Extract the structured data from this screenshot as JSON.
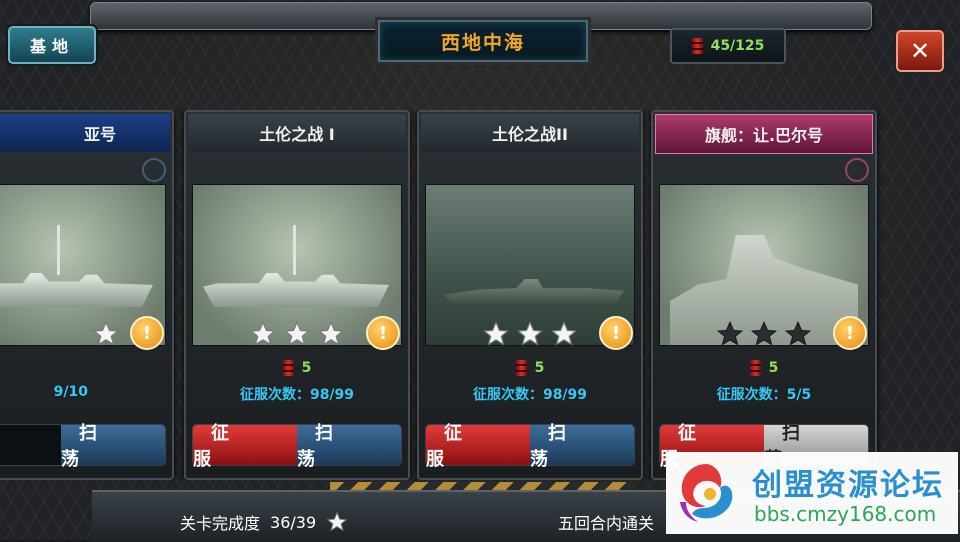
{
  "header": {
    "base_button": "基地",
    "region_title": "西地中海",
    "energy": "45/125",
    "close_label": "✕"
  },
  "cards": [
    {
      "title": "亚号",
      "cost": "",
      "conquer_count": "9/10",
      "stars_earned": 3,
      "conquer_label": "",
      "sweep_label": "扫 荡"
    },
    {
      "title": "土伦之战 I",
      "cost": "5",
      "conquer_count": "征服次数：98/99",
      "stars_earned": 3,
      "conquer_label": "征 服",
      "sweep_label": "扫 荡"
    },
    {
      "title": "土伦之战II",
      "cost": "5",
      "conquer_count": "征服次数：98/99",
      "stars_earned": 3,
      "conquer_label": "征 服",
      "sweep_label": "扫 荡"
    },
    {
      "title": "旗舰：让.巴尔号",
      "cost": "5",
      "conquer_count": "征服次数：5/5",
      "stars_earned": 0,
      "conquer_label": "征 服",
      "sweep_label": "扫 荡"
    }
  ],
  "footer": {
    "progress_label": "关卡完成度",
    "progress_value": "36/39",
    "bonus_text": "五回合内通关"
  },
  "watermark": {
    "title": "创盟资源论坛",
    "url": "bbs.cmzy168.com"
  },
  "colors": {
    "title_orange": "#f3a72a",
    "count_blue": "#39c6f0",
    "cost_green": "#8fe05a",
    "conquer_red": "#e33a3a",
    "sweep_blue": "#3d6d9a"
  },
  "icons": [
    "fuel-icon",
    "star-icon",
    "alert-icon",
    "close-icon"
  ]
}
